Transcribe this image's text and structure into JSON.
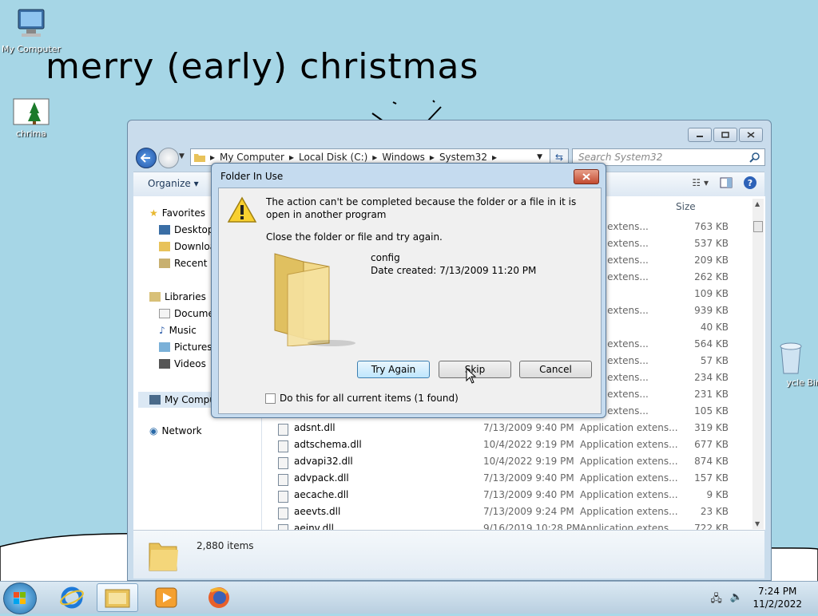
{
  "desktop": {
    "greeting": "merry (early) christmas",
    "icons": [
      {
        "label": "My Computer",
        "icon": "computer-icon"
      },
      {
        "label": "chrima",
        "icon": "image-file-icon"
      },
      {
        "label": "ycle Bin",
        "icon": "recycle-bin-icon"
      }
    ]
  },
  "explorer": {
    "breadcrumb": [
      "My Computer",
      "Local Disk (C:)",
      "Windows",
      "System32"
    ],
    "search_placeholder": "Search System32",
    "organize_label": "Organize ▾",
    "column_size": "Size",
    "nav": {
      "favorites": "Favorites",
      "desktop": "Desktop",
      "downloads": "Downloa",
      "recent": "Recent P",
      "libraries": "Libraries",
      "documents": "Docume",
      "music": "Music",
      "pictures": "Pictures",
      "videos": "Videos",
      "computer": "My Compu",
      "network": "Network"
    },
    "partial_rows": [
      {
        "type": "ation extens...",
        "size": "763 KB"
      },
      {
        "type": "ation extens...",
        "size": "537 KB"
      },
      {
        "type": "ation extens...",
        "size": "209 KB"
      },
      {
        "type": "ation extens...",
        "size": "262 KB"
      },
      {
        "type": "e",
        "size": "109 KB"
      },
      {
        "type": "ation extens...",
        "size": "939 KB"
      },
      {
        "type": "ation",
        "size": "40 KB"
      },
      {
        "type": "ation extens...",
        "size": "564 KB"
      },
      {
        "type": "ation extens...",
        "size": "57 KB"
      },
      {
        "type": "ation extens...",
        "size": "234 KB"
      },
      {
        "type": "ation extens...",
        "size": "231 KB"
      },
      {
        "type": "ation extens...",
        "size": "105 KB"
      }
    ],
    "rows": [
      {
        "name": "adsnt.dll",
        "date": "7/13/2009 9:40 PM",
        "type": "Application extens...",
        "size": "319 KB"
      },
      {
        "name": "adtschema.dll",
        "date": "10/4/2022 9:19 PM",
        "type": "Application extens...",
        "size": "677 KB"
      },
      {
        "name": "advapi32.dll",
        "date": "10/4/2022 9:19 PM",
        "type": "Application extens...",
        "size": "874 KB"
      },
      {
        "name": "advpack.dll",
        "date": "7/13/2009 9:40 PM",
        "type": "Application extens...",
        "size": "157 KB"
      },
      {
        "name": "aecache.dll",
        "date": "7/13/2009 9:40 PM",
        "type": "Application extens...",
        "size": "9 KB"
      },
      {
        "name": "aeevts.dll",
        "date": "7/13/2009 9:24 PM",
        "type": "Application extens...",
        "size": "23 KB"
      },
      {
        "name": "aeinv.dll",
        "date": "9/16/2019 10:28 PM",
        "type": "Application extens...",
        "size": "722 KB"
      }
    ],
    "status": "2,880 items"
  },
  "dialog": {
    "title": "Folder In Use",
    "message": "The action can't be completed because the folder or a file in it is open in another program",
    "instruction": "Close the folder or file and try again.",
    "item_name": "config",
    "item_date": "Date created: 7/13/2009 11:20 PM",
    "try_again": "Try Again",
    "skip": "Skip",
    "cancel": "Cancel",
    "checkbox_label": "Do this for all current items (1 found)"
  },
  "taskbar": {
    "time": "7:24 PM",
    "date": "11/2/2022",
    "apps": [
      "internet-explorer-icon",
      "file-explorer-icon",
      "media-player-icon",
      "firefox-icon"
    ]
  }
}
